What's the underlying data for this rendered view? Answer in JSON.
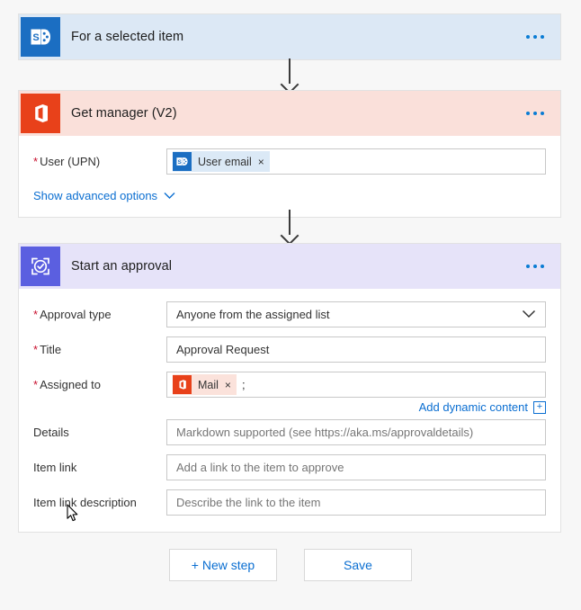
{
  "theme": {
    "page_bg": "#f7f7f7",
    "trigger_header_bg": "#dce8f5",
    "office_header_bg": "#fae0da",
    "approval_header_bg": "#e6e3f9",
    "sharepoint_icon_bg": "#1b6ec2",
    "office_icon_bg": "#e8411a",
    "approvals_icon_bg": "#5b5fe0",
    "link_blue": "#0a6ed1",
    "required_red": "#c8102e"
  },
  "trigger_card": {
    "title": "For a selected item",
    "icon": "sharepoint-icon",
    "menu": "more-options-icon"
  },
  "manager_card": {
    "title": "Get manager (V2)",
    "icon": "office365-icon",
    "menu": "more-options-icon",
    "fields": [
      {
        "label": "User (UPN)",
        "required": true,
        "token": {
          "label": "User email",
          "icon": "sharepoint-icon",
          "remove": "×"
        }
      }
    ],
    "advanced_link": "Show advanced options",
    "advanced_chevron": "chevron-down-icon"
  },
  "approval_card": {
    "title": "Start an approval",
    "icon": "approvals-icon",
    "menu": "more-options-icon",
    "approval_type": {
      "label": "Approval type",
      "required": true,
      "value": "Anyone from the assigned list",
      "chevron": "chevron-down-icon"
    },
    "title_field": {
      "label": "Title",
      "required": true,
      "value": "Approval Request"
    },
    "assigned_to": {
      "label": "Assigned to",
      "required": true,
      "token": {
        "label": "Mail",
        "icon": "office365-icon",
        "remove": "×"
      },
      "separator": ";"
    },
    "dynamic_content": {
      "label": "Add dynamic content",
      "plus": "+"
    },
    "details": {
      "label": "Details",
      "required": false,
      "placeholder": "Markdown supported (see https://aka.ms/approvaldetails)"
    },
    "item_link": {
      "label": "Item link",
      "required": false,
      "placeholder": "Add a link to the item to approve"
    },
    "item_link_description": {
      "label": "Item link description",
      "required": false,
      "placeholder": "Describe the link to the item"
    }
  },
  "connectors": [
    {
      "name": "trigger-to-manager"
    },
    {
      "name": "manager-to-approval"
    }
  ],
  "footer": {
    "new_step_label": "+ New step",
    "save_label": "Save"
  }
}
